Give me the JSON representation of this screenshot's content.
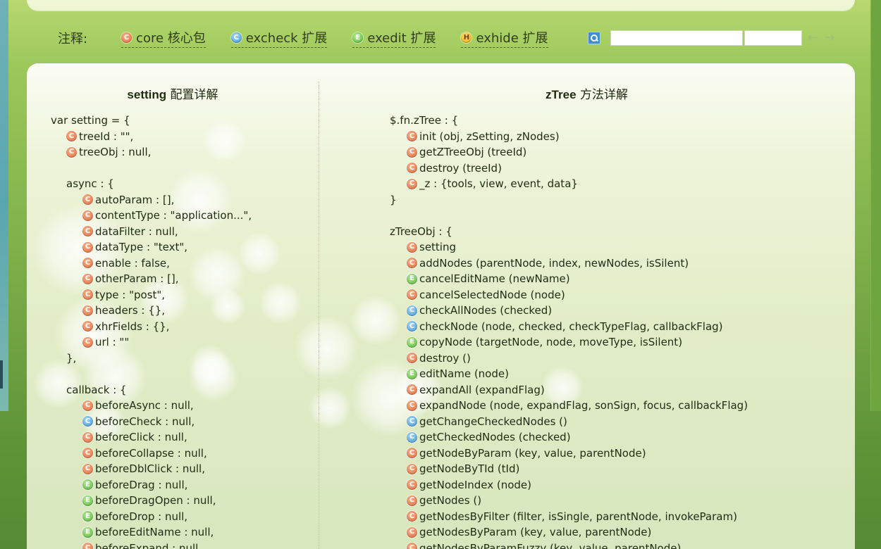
{
  "legend": {
    "label": "注释:",
    "items": [
      {
        "badge": "C",
        "type": "core",
        "text": "core 核心包"
      },
      {
        "badge": "C",
        "type": "check",
        "text": "excheck 扩展"
      },
      {
        "badge": "E",
        "type": "edit",
        "text": "exedit 扩展"
      },
      {
        "badge": "H",
        "type": "hide",
        "text": "exhide 扩展"
      }
    ]
  },
  "search": {
    "value": "",
    "value2": ""
  },
  "icons": {
    "prev": "←",
    "next": "→"
  },
  "setting": {
    "title_bold": "setting",
    "title_rest": " 配置详解",
    "open": "var setting = {",
    "top_items": [
      {
        "badge": "C",
        "type": "core",
        "text": "treeId : \"\","
      },
      {
        "badge": "C",
        "type": "core",
        "text": "treeObj : null,"
      }
    ],
    "async_open": "async : {",
    "async_items": [
      {
        "badge": "C",
        "type": "core",
        "text": "autoParam : [],"
      },
      {
        "badge": "C",
        "type": "core",
        "text": "contentType : \"application...\","
      },
      {
        "badge": "C",
        "type": "core",
        "text": "dataFilter : null,"
      },
      {
        "badge": "C",
        "type": "core",
        "text": "dataType : \"text\","
      },
      {
        "badge": "C",
        "type": "core",
        "text": "enable : false,"
      },
      {
        "badge": "C",
        "type": "core",
        "text": "otherParam : [],"
      },
      {
        "badge": "C",
        "type": "core",
        "text": "type : \"post\","
      },
      {
        "badge": "C",
        "type": "core",
        "text": "headers : {},"
      },
      {
        "badge": "C",
        "type": "core",
        "text": "xhrFields : {},"
      },
      {
        "badge": "C",
        "type": "core",
        "text": "url : \"\""
      }
    ],
    "async_close": "},",
    "callback_open": "callback : {",
    "callback_items": [
      {
        "badge": "C",
        "type": "core",
        "text": "beforeAsync : null,"
      },
      {
        "badge": "C",
        "type": "check",
        "text": "beforeCheck : null,"
      },
      {
        "badge": "C",
        "type": "core",
        "text": "beforeClick : null,"
      },
      {
        "badge": "C",
        "type": "core",
        "text": "beforeCollapse : null,"
      },
      {
        "badge": "C",
        "type": "core",
        "text": "beforeDblClick : null,"
      },
      {
        "badge": "E",
        "type": "edit",
        "text": "beforeDrag : null,"
      },
      {
        "badge": "E",
        "type": "edit",
        "text": "beforeDragOpen : null,"
      },
      {
        "badge": "E",
        "type": "edit",
        "text": "beforeDrop : null,"
      },
      {
        "badge": "E",
        "type": "edit",
        "text": "beforeEditName : null,"
      },
      {
        "badge": "C",
        "type": "core",
        "text": "beforeExpand : null,"
      }
    ]
  },
  "methods": {
    "title_bold": "zTree",
    "title_rest": " 方法详解",
    "fn_open": "$.fn.zTree : {",
    "fn_items": [
      {
        "badge": "C",
        "type": "core",
        "text": "init (obj, zSetting, zNodes)"
      },
      {
        "badge": "C",
        "type": "core",
        "text": "getZTreeObj (treeId)"
      },
      {
        "badge": "C",
        "type": "core",
        "text": "destroy (treeId)"
      },
      {
        "badge": "C",
        "type": "core",
        "text": "_z : {tools, view, event, data}"
      }
    ],
    "fn_close": "}",
    "obj_open": "zTreeObj : {",
    "obj_items": [
      {
        "badge": "C",
        "type": "core",
        "text": "setting"
      },
      {
        "badge": "C",
        "type": "core",
        "text": "addNodes (parentNode, index, newNodes, isSilent)"
      },
      {
        "badge": "E",
        "type": "edit",
        "text": "cancelEditName (newName)"
      },
      {
        "badge": "C",
        "type": "core",
        "text": "cancelSelectedNode (node)"
      },
      {
        "badge": "C",
        "type": "check",
        "text": "checkAllNodes (checked)"
      },
      {
        "badge": "C",
        "type": "check",
        "text": "checkNode (node, checked, checkTypeFlag, callbackFlag)"
      },
      {
        "badge": "E",
        "type": "edit",
        "text": "copyNode (targetNode, node, moveType, isSilent)"
      },
      {
        "badge": "C",
        "type": "core",
        "text": "destroy ()"
      },
      {
        "badge": "E",
        "type": "edit",
        "text": "editName (node)"
      },
      {
        "badge": "C",
        "type": "core",
        "text": "expandAll (expandFlag)"
      },
      {
        "badge": "C",
        "type": "core",
        "text": "expandNode (node, expandFlag, sonSign, focus, callbackFlag)"
      },
      {
        "badge": "C",
        "type": "check",
        "text": "getChangeCheckedNodes ()"
      },
      {
        "badge": "C",
        "type": "check",
        "text": "getCheckedNodes (checked)"
      },
      {
        "badge": "C",
        "type": "core",
        "text": "getNodeByParam (key, value, parentNode)"
      },
      {
        "badge": "C",
        "type": "core",
        "text": "getNodeByTId (tId)"
      },
      {
        "badge": "C",
        "type": "core",
        "text": "getNodeIndex (node)"
      },
      {
        "badge": "C",
        "type": "core",
        "text": "getNodes ()"
      },
      {
        "badge": "C",
        "type": "core",
        "text": "getNodesByFilter (filter, isSingle, parentNode, invokeParam)"
      },
      {
        "badge": "C",
        "type": "core",
        "text": "getNodesByParam (key, value, parentNode)"
      },
      {
        "badge": "C",
        "type": "core",
        "text": "getNodesByParamFuzzy (key, value, parentNode)"
      }
    ]
  }
}
